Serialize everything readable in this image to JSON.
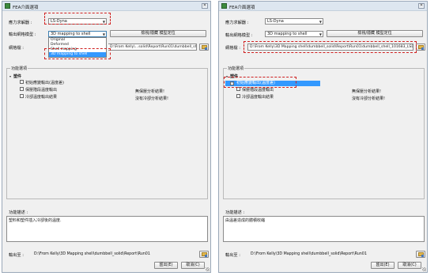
{
  "left": {
    "title": "FEA介面選項",
    "solver_label": "應力求解器 :",
    "solver_value": "LS-Dyna",
    "mesh_output_label": "輸出網格模型 :",
    "mesh_output_value": "3D mapping to shell",
    "view_model_button": "檢視/隱藏 模型定位",
    "mesh_file_label": "網格檔 :",
    "mesh_file_path": "D:\\From Kelly\\...solid\\Report\\Run01\\dumbbell_shell_101683_LSDYI",
    "dropdown_options": [
      "Original",
      "Deformed",
      "Shell mapping",
      "3D mapping to shell"
    ],
    "dropdown_selected": "3D mapping to shell",
    "function_options_title": "功能選項",
    "tree_root": "塑件",
    "tree_items": [
      {
        "label": "初始應變輸出(溫度差)",
        "checked": false,
        "note": ""
      },
      {
        "label": "保壓階段溫度輸出",
        "checked": false,
        "note": "無保壓分析結果!"
      },
      {
        "label": "冷卻溫度輸出結果",
        "checked": false,
        "note": "沒有冷卻分析結果!"
      }
    ],
    "description_label": "功能描述 :",
    "description_text": "塑料和塑件插入冷卻後的溫度.",
    "output_label": "輸出至 :",
    "output_path": "D:\\From Kelly\\3D Mapping shell\\dumbbell_solid\\Report\\Run01",
    "export_button": "匯出(E)",
    "cancel_button": "取消(C)"
  },
  "right": {
    "title": "FEA介面選項",
    "solver_label": "應力求解器 :",
    "solver_value": "LS-Dyna",
    "mesh_output_label": "輸出網格模型 :",
    "mesh_output_value": "3D mapping to shell",
    "view_model_button": "檢視/隱藏 模型定位",
    "mesh_file_label": "網格檔 :",
    "mesh_file_path": "D:\\From Kelly\\3D Mapping shell\\dumbbell_solid\\Report\\Run01\\dumbbell_shell_101683_LSDYI",
    "function_options_title": "功能選項",
    "tree_root": "塑件",
    "tree_items": [
      {
        "label": "初始應變輸出(溫度差)",
        "checked": true,
        "note": ""
      },
      {
        "label": "保壓階段溫度輸出",
        "checked": false,
        "note": "無保壓分析結果!"
      },
      {
        "label": "冷卻溫度輸出結果",
        "checked": false,
        "note": "沒有冷卻分析結果!"
      }
    ],
    "description_label": "功能描述 :",
    "description_text": "由溫差造成的體積收縮",
    "output_label": "輸出至 :",
    "output_path": "D:\\From Kelly\\3D Mapping shell\\dumbbell_solid\\Report\\Run01",
    "export_button": "匯出(E)",
    "cancel_button": "取消(C)"
  },
  "colors": {
    "selection": "#3399ff",
    "annotation": "#d02020",
    "dialog_bg": "#f0f0f0"
  }
}
